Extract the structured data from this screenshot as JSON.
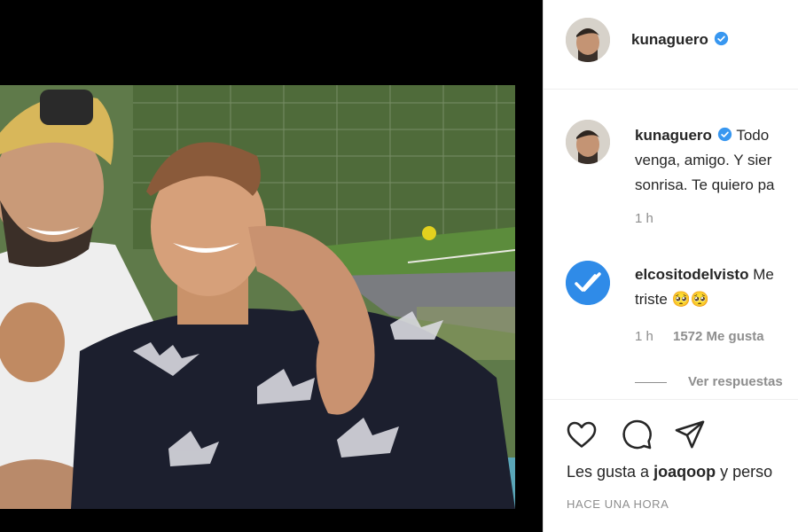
{
  "post": {
    "username": "kunaguero",
    "verified": true,
    "image_alt": "Photo of two men smiling, one with arm around the other, in front of a football pitch"
  },
  "caption": {
    "username": "kunaguero",
    "text_line1": "Todo",
    "text_line2": "venga, amigo. Y sier",
    "text_line3": "sonrisa. Te quiero pa",
    "age": "1 h"
  },
  "comments": [
    {
      "username": "elcositodelvisto",
      "text_line1": "Me",
      "text_line2": "triste 🥺🥺",
      "age": "1 h",
      "likes": "1572 Me gusta",
      "view_replies": "Ver respuestas"
    }
  ],
  "actions": {
    "like_icon": "heart-icon",
    "comment_icon": "comment-icon",
    "share_icon": "share-icon"
  },
  "likes_summary": {
    "prefix": "Les gusta a",
    "user": "joaqoop",
    "suffix": "y perso"
  },
  "timestamp": "HACE UNA HORA",
  "colors": {
    "verified": "#3897f0",
    "meta_text": "#8e8e8e",
    "text": "#262626",
    "comment_avatar": "#3897f0"
  }
}
